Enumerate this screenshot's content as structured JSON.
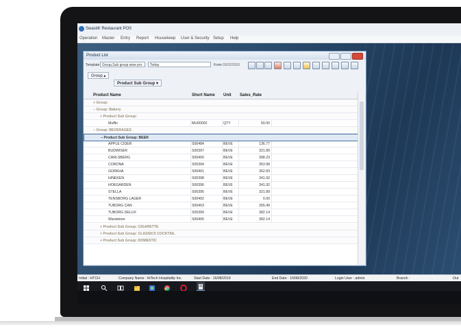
{
  "app": {
    "title": "SwastiK Restaurant POS",
    "menu": [
      "Operation",
      "Master",
      "Entry",
      "Report",
      "Housekeep",
      "User & Security",
      "Setup",
      "Help"
    ]
  },
  "window": {
    "title": "Product List",
    "template_label": "Template",
    "template_value": "Group,Sub group wise pro",
    "period_value": "Today",
    "from_label": "From",
    "from_date": "03/02/2020",
    "group_label": "Group",
    "subgroup_label": "Product Sub Group"
  },
  "table": {
    "columns": [
      "Product Name",
      "Short Name",
      "Unit",
      "Sales_Rate"
    ],
    "groups": [
      {
        "label": "Group:"
      },
      {
        "label": "Group: Bakery"
      },
      {
        "label": "Product Sub Group:"
      },
      {
        "label": "Group: BEVERAGES"
      },
      {
        "label": "Product Sub Group: BEER"
      }
    ],
    "rows": [
      {
        "name": "Muffin",
        "short": "MU00002",
        "unit": "QTY",
        "rate": "50.00"
      },
      {
        "name": "APPLE CIDER",
        "short": "S00484",
        "unit": "BEVE",
        "rate": "136.77"
      },
      {
        "name": "BUDWISER",
        "short": "S00397",
        "unit": "BEVE",
        "rate": "321.89"
      },
      {
        "name": "CARLSBERG",
        "short": "S00400",
        "unit": "BEVE",
        "rate": "398.23"
      },
      {
        "name": "CORONA",
        "short": "S00394",
        "unit": "BEVE",
        "rate": "353.98"
      },
      {
        "name": "GORKHA",
        "short": "S00401",
        "unit": "BEVE",
        "rate": "362.83"
      },
      {
        "name": "HINEKEN",
        "short": "S00398",
        "unit": "BEVE",
        "rate": "341.92"
      },
      {
        "name": "HOEGARDEN",
        "short": "S00396",
        "unit": "BEVE",
        "rate": "341.92"
      },
      {
        "name": "STELLA",
        "short": "S00395",
        "unit": "BEVE",
        "rate": "321.89"
      },
      {
        "name": "TENSBORG LAGER",
        "short": "S00402",
        "unit": "BEVE",
        "rate": "0.00"
      },
      {
        "name": "TUBORG CAN",
        "short": "S00403",
        "unit": "BEVE",
        "rate": "265.49"
      },
      {
        "name": "TUBORG DELUX",
        "short": "S00399",
        "unit": "BEVE",
        "rate": "382.14"
      },
      {
        "name": "Warsteiner",
        "short": "S00405",
        "unit": "BEVE",
        "rate": "382.14"
      }
    ],
    "trailing_groups": [
      "Product Sub Group: CIGARETTE",
      "Product Sub Group: CLASSICS COCKTAIL",
      "Product Sub Group: DOMESTIC"
    ]
  },
  "status": {
    "initial": "Initial : HTCH",
    "company": "Company Name : HiTech Hospitality Inc.",
    "start": "Start Date : 16/08/2019",
    "end": "End Date : 15/08/2020",
    "login": "Login User : admin",
    "branch": "Branch :",
    "out": "Out"
  },
  "colors": {
    "accent": "#2f6fb7",
    "desktop": "#2b4d6e",
    "group_text": "#9a8f7a"
  },
  "icons": [
    "windows-start-icon",
    "search-icon",
    "task-view-icon",
    "file-explorer-icon",
    "app-icon",
    "chrome-icon",
    "opera-icon",
    "pos-app-icon"
  ]
}
